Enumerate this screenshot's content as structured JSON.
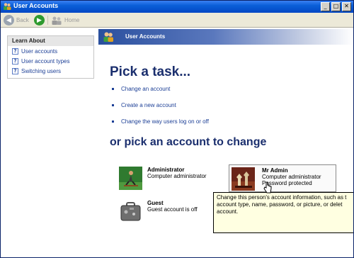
{
  "window": {
    "title": "User Accounts",
    "controls": [
      "_",
      "□",
      "✕"
    ]
  },
  "toolbar": {
    "back_label": "Back",
    "home_label": "Home"
  },
  "learn_about": {
    "heading": "Learn About",
    "items": [
      {
        "label": "User accounts"
      },
      {
        "label": "User account types"
      },
      {
        "label": "Switching users"
      }
    ]
  },
  "banner": {
    "title": "User Accounts"
  },
  "tasks": {
    "heading": "Pick a task...",
    "items": [
      {
        "label": "Change an account"
      },
      {
        "label": "Create a new account"
      },
      {
        "label": "Change the way users log on or off"
      }
    ]
  },
  "accounts": {
    "heading": "or pick an account to change",
    "items": [
      {
        "name": "Administrator",
        "type": "Computer administrator",
        "extra": ""
      },
      {
        "name": "Mr Admin",
        "type": "Computer administrator",
        "extra": "Password protected"
      },
      {
        "name": "Guest",
        "type": "Guest account is off",
        "extra": ""
      }
    ]
  },
  "tooltip": {
    "lines": [
      "Change this person's account information, such as t",
      "account type, name, password, or picture, or delet",
      "account."
    ]
  },
  "colors": {
    "titlebar": "#0a5fd8",
    "heading": "#1b2f6e",
    "link": "#1c3f96",
    "tooltip_bg": "#ffffe1"
  }
}
